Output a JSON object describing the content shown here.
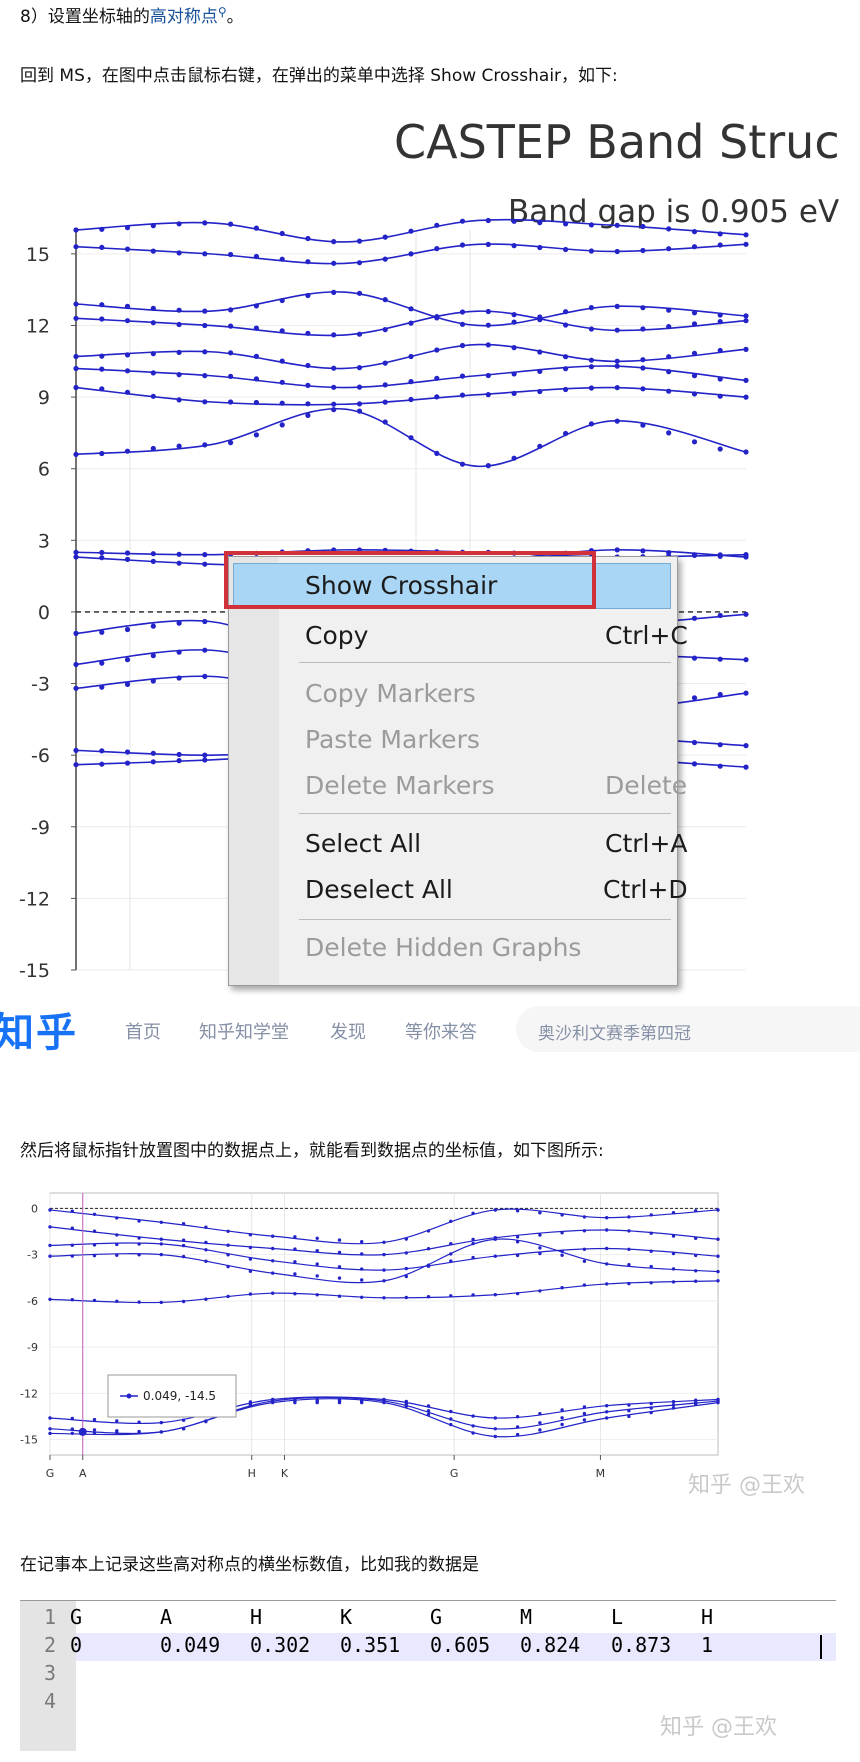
{
  "step_heading": {
    "prefix": "8）设置坐标轴的",
    "link": "高对称点",
    "suffix": "。"
  },
  "para_menu": "回到 MS，在图中点击鼠标右键，在弹出的菜单中选择 Show Crosshair，如下:",
  "para_hover": "然后将鼠标指针放置图中的数据点上，就能看到数据点的坐标值，如下图所示:",
  "para_record": "在记事本上记录这些高对称点的横坐标数值，比如我的数据是",
  "chart1": {
    "title": "CASTEP Band Struc",
    "subtitle": "Band gap is 0.905 eV",
    "yticks": [
      "15",
      "12",
      "9",
      "6",
      "3",
      "0",
      "-3",
      "-6",
      "-9",
      "-12",
      "-15"
    ]
  },
  "context_menu": {
    "items": [
      {
        "label": "Show Crosshair",
        "shortcut": "",
        "disabled": false
      },
      {
        "label": "Copy",
        "shortcut": "Ctrl+C",
        "disabled": false
      },
      {
        "label": "Copy Markers",
        "shortcut": "",
        "disabled": true
      },
      {
        "label": "Paste Markers",
        "shortcut": "",
        "disabled": true
      },
      {
        "label": "Delete Markers",
        "shortcut": "Delete",
        "disabled": true
      },
      {
        "label": "Select All",
        "shortcut": "Ctrl+A",
        "disabled": false
      },
      {
        "label": "Deselect All",
        "shortcut": "Ctrl+D",
        "disabled": false
      },
      {
        "label": "Delete Hidden Graphs",
        "shortcut": "",
        "disabled": true
      }
    ]
  },
  "zhihu_header": {
    "logo": "知乎",
    "nav": [
      "首页",
      "知乎知学堂",
      "发现",
      "等你来答"
    ],
    "search_placeholder": "奥沙利文赛季第四冠"
  },
  "chart2": {
    "yticks": [
      "0",
      "-3",
      "-6",
      "-9",
      "-12",
      "-15"
    ],
    "xticks": [
      "G",
      "A",
      "H",
      "K",
      "G",
      "M"
    ],
    "tooltip": "0.049, -14.5",
    "watermark": "知乎 @王欢"
  },
  "chart_data": [
    {
      "type": "line",
      "title": "CASTEP Band Struc",
      "subtitle": "Band gap is 0.905 eV",
      "ylim": [
        -15,
        16
      ],
      "yticks": [
        15,
        12,
        9,
        6,
        3,
        0,
        -3,
        -6,
        -9,
        -12,
        -15
      ],
      "fermi_level": 0,
      "series": [
        {
          "values": [
            16.0,
            16.3,
            15.5,
            16.4,
            16.2,
            15.8
          ]
        },
        {
          "values": [
            15.3,
            15.0,
            14.6,
            15.4,
            15.1,
            15.4
          ]
        },
        {
          "values": [
            12.9,
            12.6,
            13.4,
            12.0,
            12.8,
            12.4
          ]
        },
        {
          "values": [
            12.3,
            12.0,
            11.6,
            12.6,
            11.8,
            12.2
          ]
        },
        {
          "values": [
            10.7,
            10.9,
            10.2,
            11.2,
            10.5,
            11.0
          ]
        },
        {
          "values": [
            10.2,
            9.9,
            9.4,
            9.9,
            10.3,
            9.7
          ]
        },
        {
          "values": [
            9.4,
            8.8,
            8.7,
            9.1,
            9.4,
            9.0
          ]
        },
        {
          "values": [
            6.6,
            7.0,
            8.5,
            6.1,
            8.0,
            6.7
          ]
        },
        {
          "values": [
            2.5,
            2.4,
            2.6,
            2.5,
            2.3,
            2.4
          ]
        },
        {
          "values": [
            2.3,
            2.0,
            1.9,
            2.1,
            2.6,
            2.3
          ]
        },
        {
          "values": [
            -0.9,
            -0.4,
            -2.1,
            -1.2,
            -0.6,
            -0.1
          ]
        },
        {
          "values": [
            -2.2,
            -1.6,
            -2.8,
            -2.0,
            -1.8,
            -2.0
          ]
        },
        {
          "values": [
            -3.2,
            -2.7,
            -3.6,
            -3.0,
            -4.0,
            -3.4
          ]
        },
        {
          "values": [
            -5.8,
            -6.0,
            -5.7,
            -4.6,
            -5.2,
            -5.6
          ]
        },
        {
          "values": [
            -6.4,
            -6.2,
            -5.9,
            -5.5,
            -6.1,
            -6.5
          ]
        }
      ]
    },
    {
      "type": "line",
      "ylim": [
        -16,
        1
      ],
      "yticks": [
        0,
        -3,
        -6,
        -9,
        -12,
        -15
      ],
      "xticks": [
        {
          "label": "G",
          "x": 0
        },
        {
          "label": "A",
          "x": 0.049
        },
        {
          "label": "H",
          "x": 0.302
        },
        {
          "label": "K",
          "x": 0.351
        },
        {
          "label": "G",
          "x": 0.605
        },
        {
          "label": "M",
          "x": 0.824
        }
      ],
      "xlim": [
        0,
        1
      ],
      "crosshair_point": {
        "x": 0.049,
        "y": -14.5
      },
      "series": [
        {
          "values": [
            -0.1,
            -0.9,
            -1.8,
            -2.2,
            -0.1,
            -0.6,
            -0.1
          ]
        },
        {
          "values": [
            -1.2,
            -2.0,
            -2.6,
            -3.0,
            -1.9,
            -1.4,
            -2.0
          ]
        },
        {
          "values": [
            -2.4,
            -2.3,
            -3.4,
            -4.0,
            -3.1,
            -2.6,
            -3.1
          ]
        },
        {
          "values": [
            -3.1,
            -3.0,
            -4.2,
            -4.7,
            -2.0,
            -3.6,
            -4.1
          ]
        },
        {
          "values": [
            -5.9,
            -6.1,
            -5.5,
            -5.8,
            -5.6,
            -4.9,
            -4.7
          ]
        },
        {
          "values": [
            -13.6,
            -13.9,
            -12.4,
            -12.4,
            -13.6,
            -12.8,
            -12.4
          ]
        },
        {
          "values": [
            -14.3,
            -14.5,
            -12.5,
            -12.5,
            -14.3,
            -13.2,
            -12.5
          ]
        },
        {
          "values": [
            -14.6,
            -14.5,
            -12.6,
            -12.6,
            -14.8,
            -13.6,
            -12.6
          ]
        }
      ]
    },
    {
      "type": "table",
      "rows": [
        [
          "G",
          "A",
          "H",
          "K",
          "G",
          "M",
          "L",
          "H"
        ],
        [
          "0",
          "0.049",
          "0.302",
          "0.351",
          "0.605",
          "0.824",
          "0.873",
          "1"
        ]
      ]
    }
  ],
  "editor": {
    "line_numbers": [
      "1",
      "2",
      "3",
      "4"
    ],
    "row1": [
      "G",
      "A",
      "H",
      "K",
      "G",
      "M",
      "L",
      "H"
    ],
    "row2": [
      "0",
      "0.049",
      "0.302",
      "0.351",
      "0.605",
      "0.824",
      "0.873",
      "1"
    ],
    "watermark": "知乎 @王欢"
  },
  "colors": {
    "band_line": "#2323c8",
    "menu_highlight": "#a9d6f5",
    "red_outline": "#d0313a",
    "zhihu_blue": "#1772f6",
    "link": "#175199"
  }
}
